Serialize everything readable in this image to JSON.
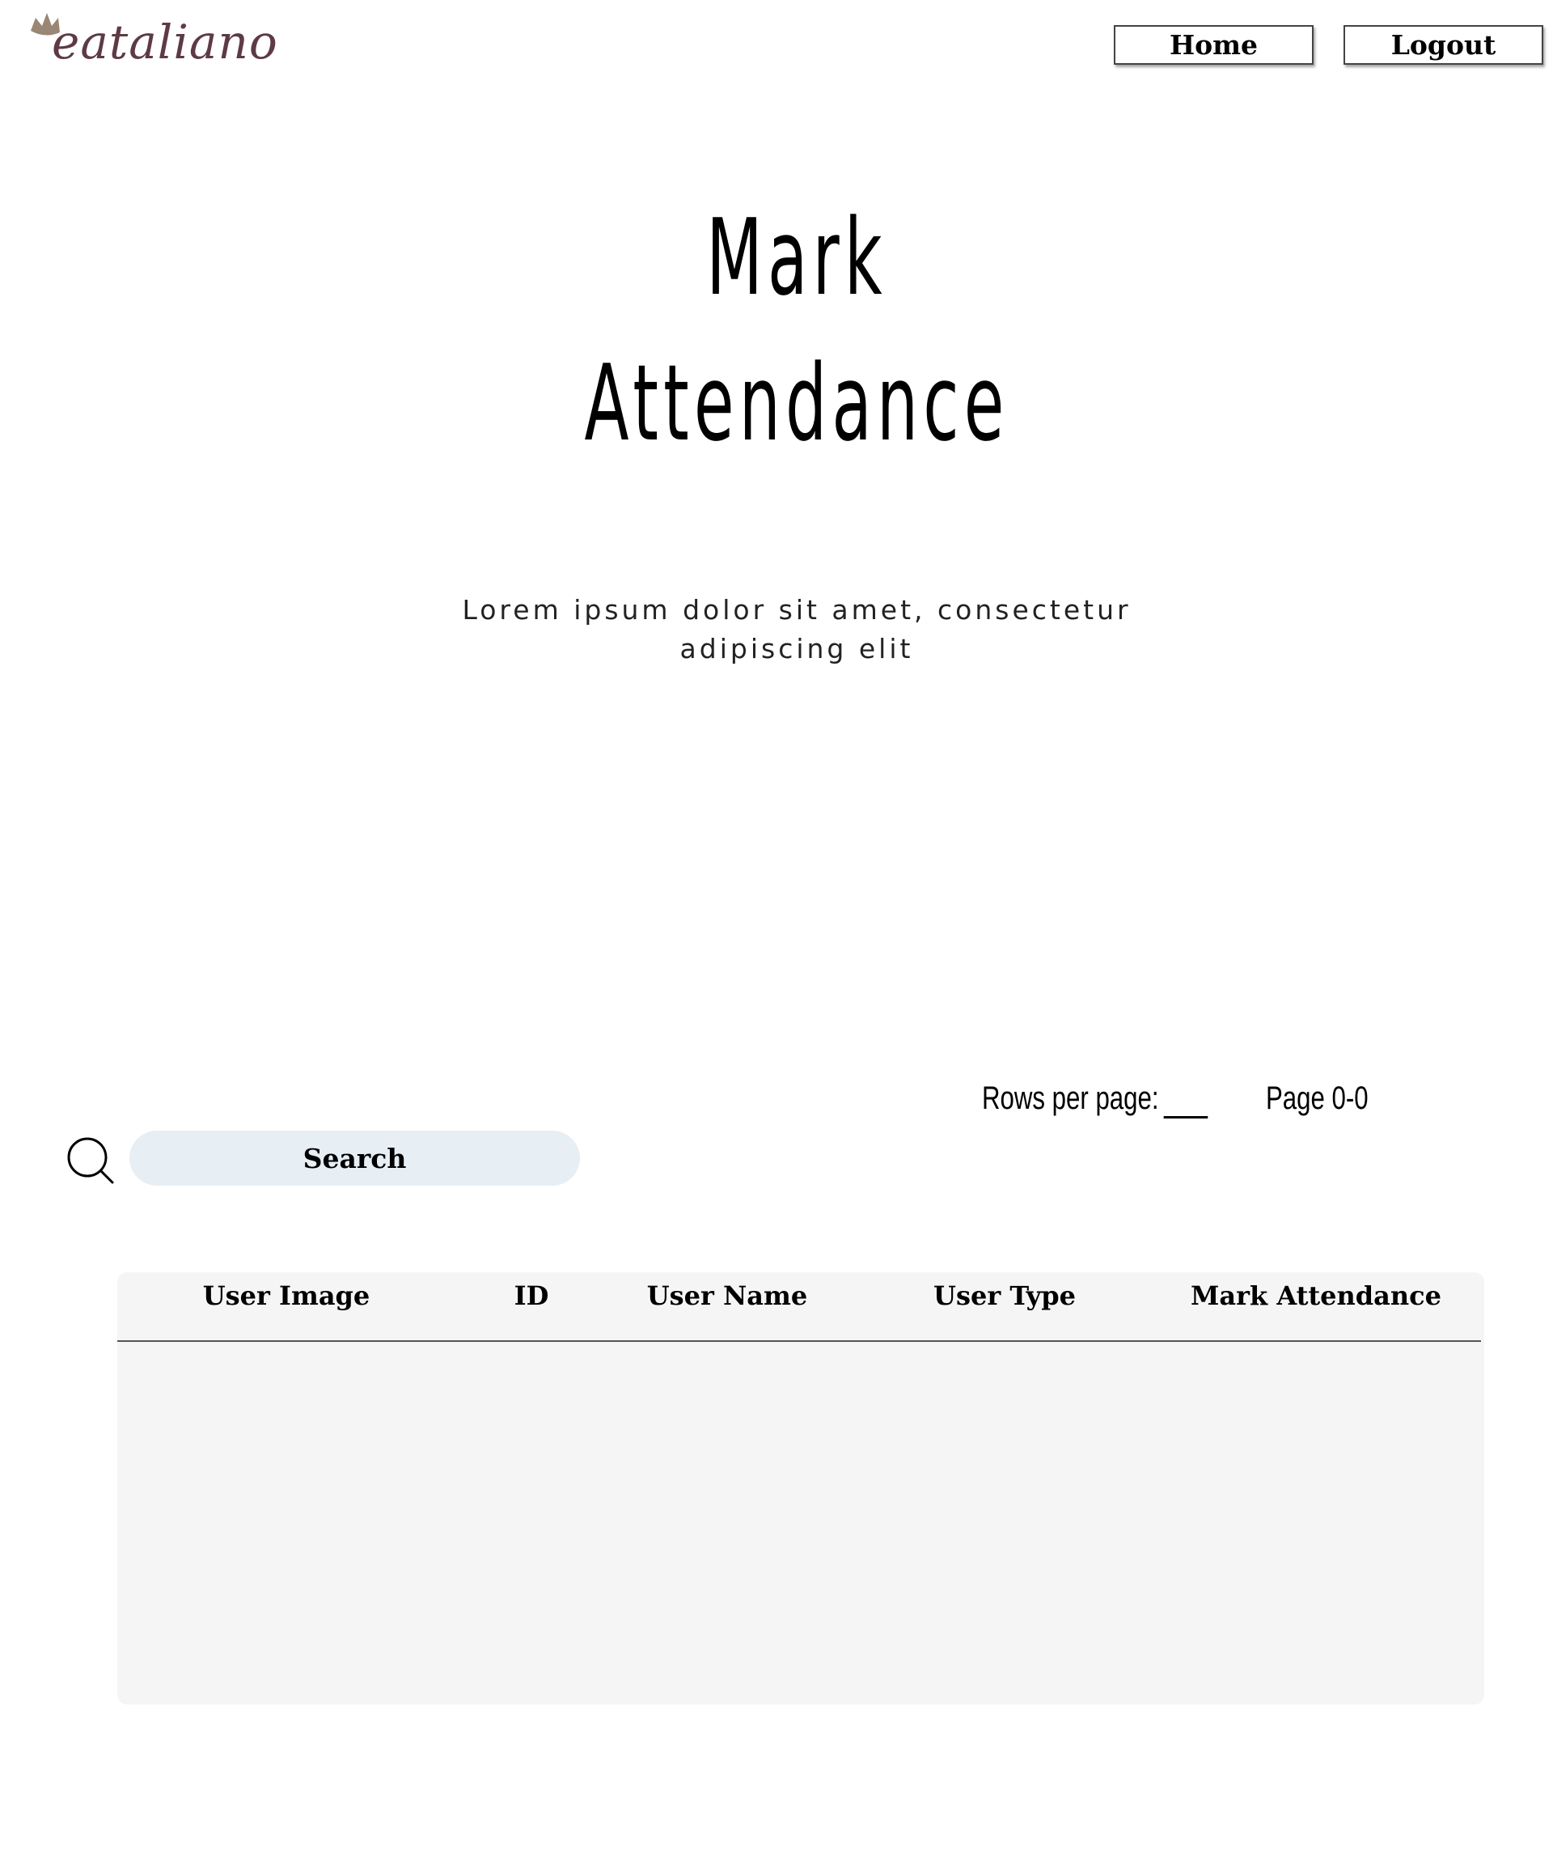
{
  "header": {
    "logo_text": "eataliano",
    "home_label": "Home",
    "logout_label": "Logout"
  },
  "hero": {
    "title_line1": "Mark",
    "title_line2": "Attendance",
    "subtitle_line1": "Lorem ipsum dolor sit amet, consectetur",
    "subtitle_line2": "adipiscing elit"
  },
  "pagination": {
    "rows_per_page_label": "Rows per page:",
    "page_indicator": "Page 0-0"
  },
  "search": {
    "icon": "search-icon",
    "placeholder": "Search",
    "value": ""
  },
  "table": {
    "columns": [
      "User Image",
      "ID",
      "User Name",
      "User Type",
      "Mark Attendance"
    ],
    "rows": []
  },
  "colors": {
    "search_background": "#e7eef4",
    "table_background": "#f5f5f5",
    "logo_text": "#5e3a44",
    "logo_crown": "#9a8674"
  }
}
